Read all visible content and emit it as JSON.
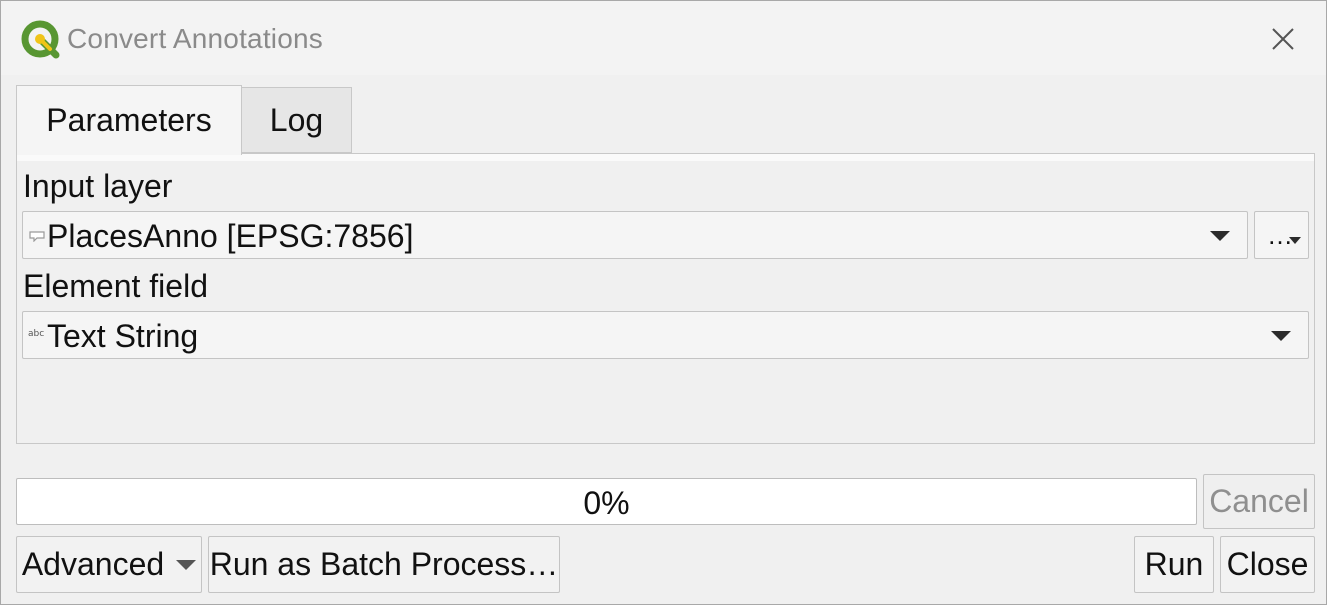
{
  "window": {
    "title": "Convert Annotations",
    "logo_icon": "qgis-logo-icon",
    "close_icon": "close-icon"
  },
  "tabs": [
    {
      "label": "Parameters",
      "active": true
    },
    {
      "label": "Log",
      "active": false
    }
  ],
  "parameters": {
    "input_layer": {
      "label": "Input layer",
      "value": "PlacesAnno [EPSG:7856]",
      "icon": "annotation-layer-icon",
      "browse_label": "…"
    },
    "element_field": {
      "label": "Element field",
      "value": "Text String",
      "icon": "text-field-icon",
      "icon_text": "abc"
    }
  },
  "progress": {
    "value": 0,
    "text": "0%"
  },
  "buttons": {
    "cancel": "Cancel",
    "advanced": "Advanced",
    "batch": "Run as Batch Process…",
    "run": "Run",
    "close": "Close"
  },
  "colors": {
    "qgis_green": "#589632",
    "qgis_yellow": "#f0c419",
    "progress_fill": "#3d8ee0"
  }
}
